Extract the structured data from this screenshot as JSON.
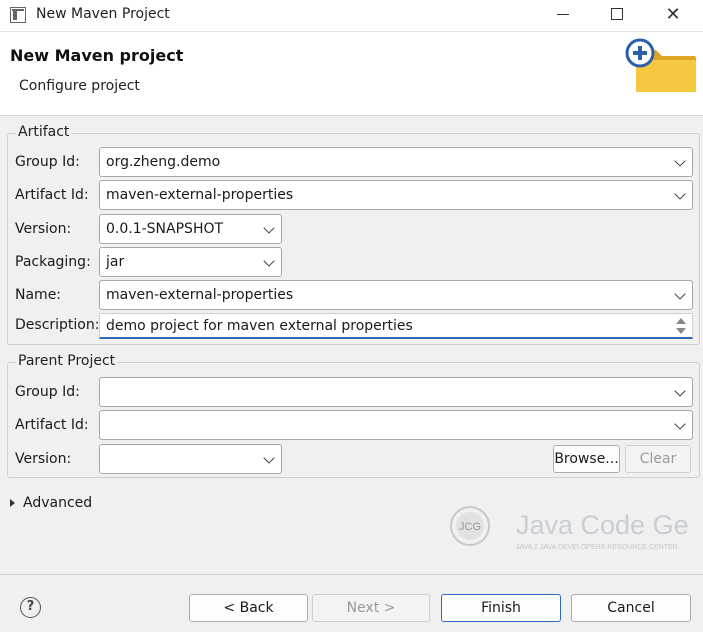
{
  "window": {
    "title": "New Maven Project"
  },
  "header": {
    "title": "New Maven project",
    "subtitle": "Configure project"
  },
  "artifact": {
    "label": "Artifact",
    "group_id": {
      "label": "Group Id:",
      "value": "org.zheng.demo"
    },
    "artifact_id": {
      "label": "Artifact Id:",
      "value": "maven-external-properties"
    },
    "version": {
      "label": "Version:",
      "value": "0.0.1-SNAPSHOT"
    },
    "packaging": {
      "label": "Packaging:",
      "value": "jar"
    },
    "name": {
      "label": "Name:",
      "value": "maven-external-properties"
    },
    "description": {
      "label": "Description:",
      "value": "demo project for maven external properties"
    }
  },
  "parent": {
    "label": "Parent Project",
    "group_id": {
      "label": "Group Id:",
      "value": ""
    },
    "artifact_id": {
      "label": "Artifact Id:",
      "value": ""
    },
    "version": {
      "label": "Version:",
      "value": ""
    },
    "browse_label": "Browse...",
    "clear_label": "Clear"
  },
  "advanced": {
    "label": "Advanced"
  },
  "watermark": {
    "name": "Java Code Geeks",
    "tagline": "JAVA 2 JAVA DEVELOPERS RESOURCE CENTER",
    "logo_text": "JCG"
  },
  "footer": {
    "help_glyph": "?",
    "back_label": "< Back",
    "next_label": "Next >",
    "finish_label": "Finish",
    "cancel_label": "Cancel"
  },
  "colors": {
    "accent": "#2a6ebb",
    "field_underline": "#2b6cb0",
    "banner_folder": "#f5c842"
  }
}
